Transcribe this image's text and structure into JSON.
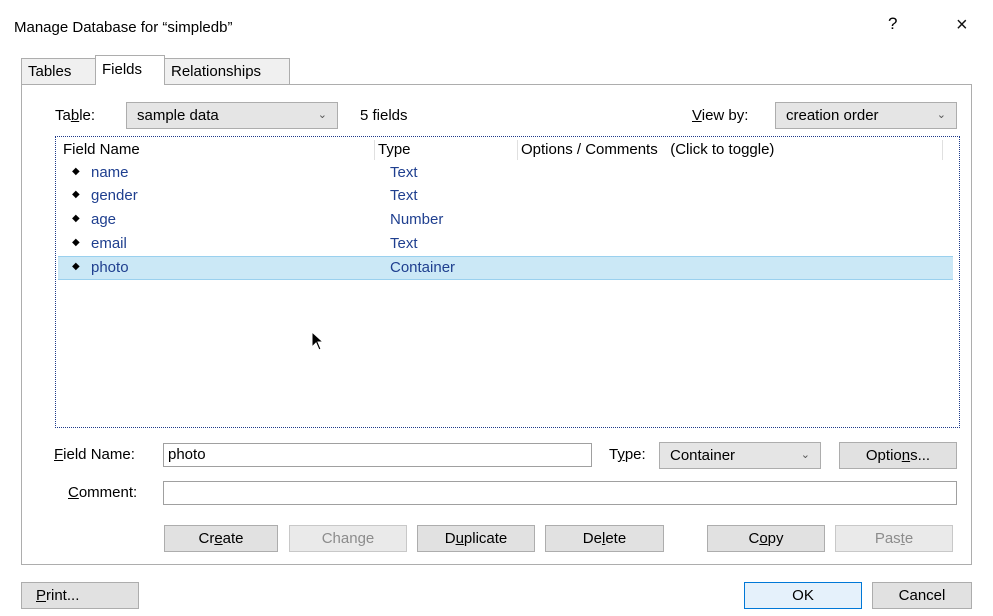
{
  "window": {
    "title": "Manage Database for “simpledb”",
    "help_label": "?",
    "close_label": "×"
  },
  "tabs": [
    {
      "label": "Tables",
      "active": false
    },
    {
      "label": "Fields",
      "active": true
    },
    {
      "label": "Relationships",
      "active": false
    }
  ],
  "table_selector": {
    "label_pre": "Ta",
    "label_mnemonic": "b",
    "label_post": "le:",
    "value": "sample data",
    "count_text": "5 fields"
  },
  "view_by": {
    "label_mnemonic": "V",
    "label_post": "iew by:",
    "value": "creation order"
  },
  "list": {
    "columns": [
      "Field Name",
      "Type",
      "Options / Comments   (Click to toggle)"
    ],
    "rows": [
      {
        "name": "name",
        "type": "Text",
        "selected": false
      },
      {
        "name": "gender",
        "type": "Text",
        "selected": false
      },
      {
        "name": "age",
        "type": "Number",
        "selected": false
      },
      {
        "name": "email",
        "type": "Text",
        "selected": false
      },
      {
        "name": "photo",
        "type": "Container",
        "selected": true
      }
    ]
  },
  "field_name": {
    "label_mnemonic": "F",
    "label_post": "ield Name:",
    "value": "photo"
  },
  "type_select": {
    "label_pre": "T",
    "label_mnemonic": "y",
    "label_post": "pe:",
    "value": "Container"
  },
  "options_button": {
    "pre": "Optio",
    "mnemonic": "n",
    "post": "s..."
  },
  "comment": {
    "label_mnemonic": "C",
    "label_post": "omment:",
    "value": ""
  },
  "action_buttons": {
    "create": {
      "pre": "Cr",
      "mnemonic": "e",
      "post": "ate"
    },
    "change": {
      "pre": "Chan",
      "mnemonic": "g",
      "post": "e"
    },
    "duplicate": {
      "pre": "D",
      "mnemonic": "u",
      "post": "plicate"
    },
    "delete": {
      "pre": "De",
      "mnemonic": "l",
      "post": "ete"
    },
    "copy": {
      "pre": "C",
      "mnemonic": "o",
      "post": "py"
    },
    "paste": {
      "pre": "Pas",
      "mnemonic": "t",
      "post": "e"
    }
  },
  "footer": {
    "print": {
      "mnemonic": "P",
      "post": "rint..."
    },
    "ok_label": "OK",
    "cancel_label": "Cancel"
  },
  "icons": {
    "chevron": "chevron-down-icon",
    "bullet": "drag-handle-icon",
    "cursor": "mouse-pointer-icon"
  }
}
